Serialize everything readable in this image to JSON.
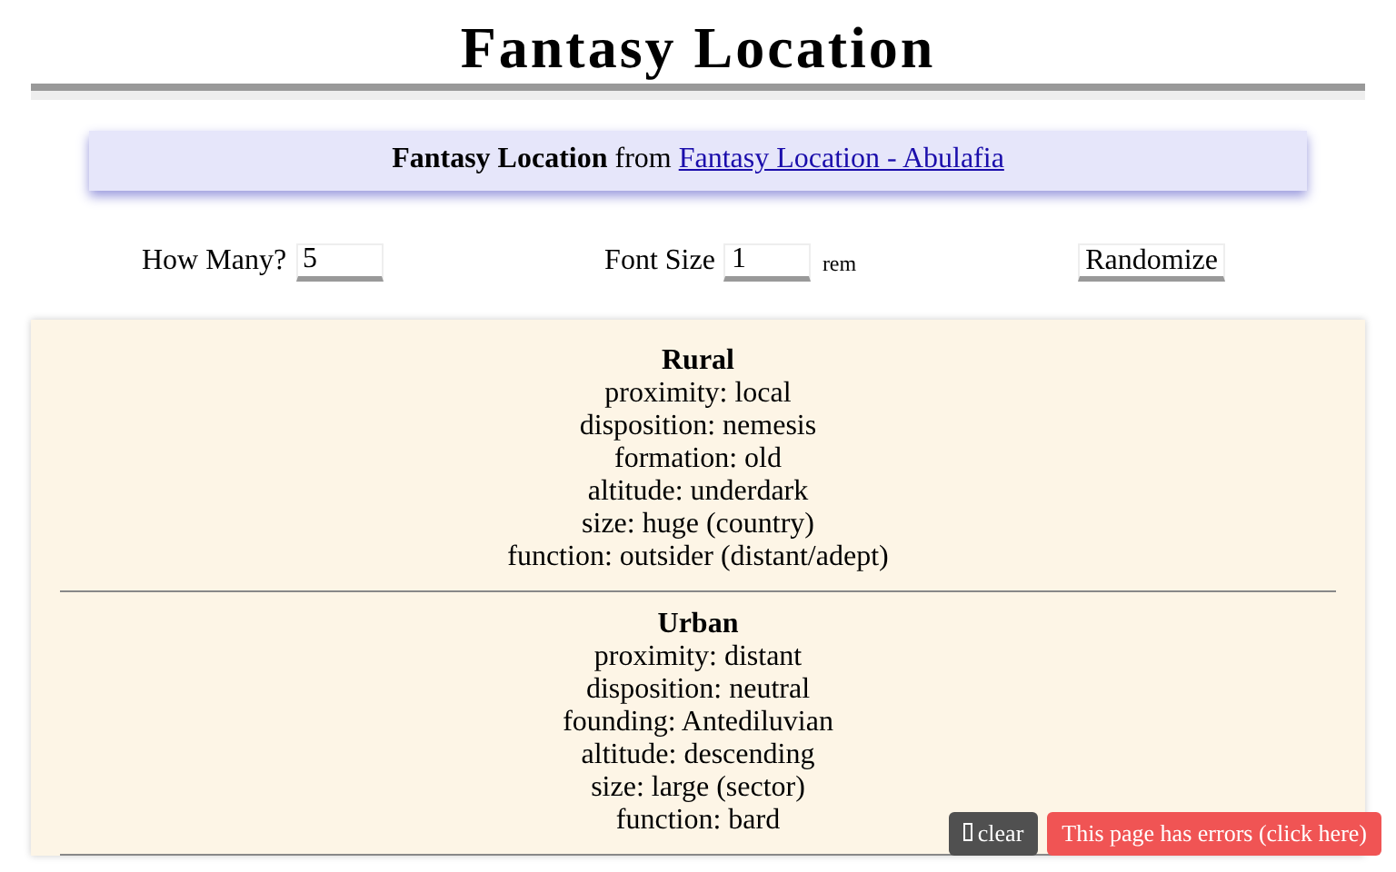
{
  "title": "Fantasy Location",
  "banner": {
    "name": "Fantasy Location",
    "from": "from",
    "link": "Fantasy Location - Abulafia"
  },
  "controls": {
    "how_many_label": "How Many?",
    "how_many": "5",
    "font_size_label": "Font Size",
    "font_size": "1",
    "unit": "rem",
    "randomize": "Randomize"
  },
  "results": [
    {
      "title": "Rural",
      "lines": [
        "proximity: local",
        "disposition: nemesis",
        "formation: old",
        "altitude: underdark",
        "size: huge (country)",
        "function: outsider (distant/adept)"
      ]
    },
    {
      "title": "Urban",
      "lines": [
        "proximity: distant",
        "disposition: neutral",
        "founding: Antediluvian",
        "altitude: descending",
        "size: large (sector)",
        "function: bard"
      ]
    }
  ],
  "overlay": {
    "clear": "clear",
    "errors": "This page has errors (click here)"
  }
}
